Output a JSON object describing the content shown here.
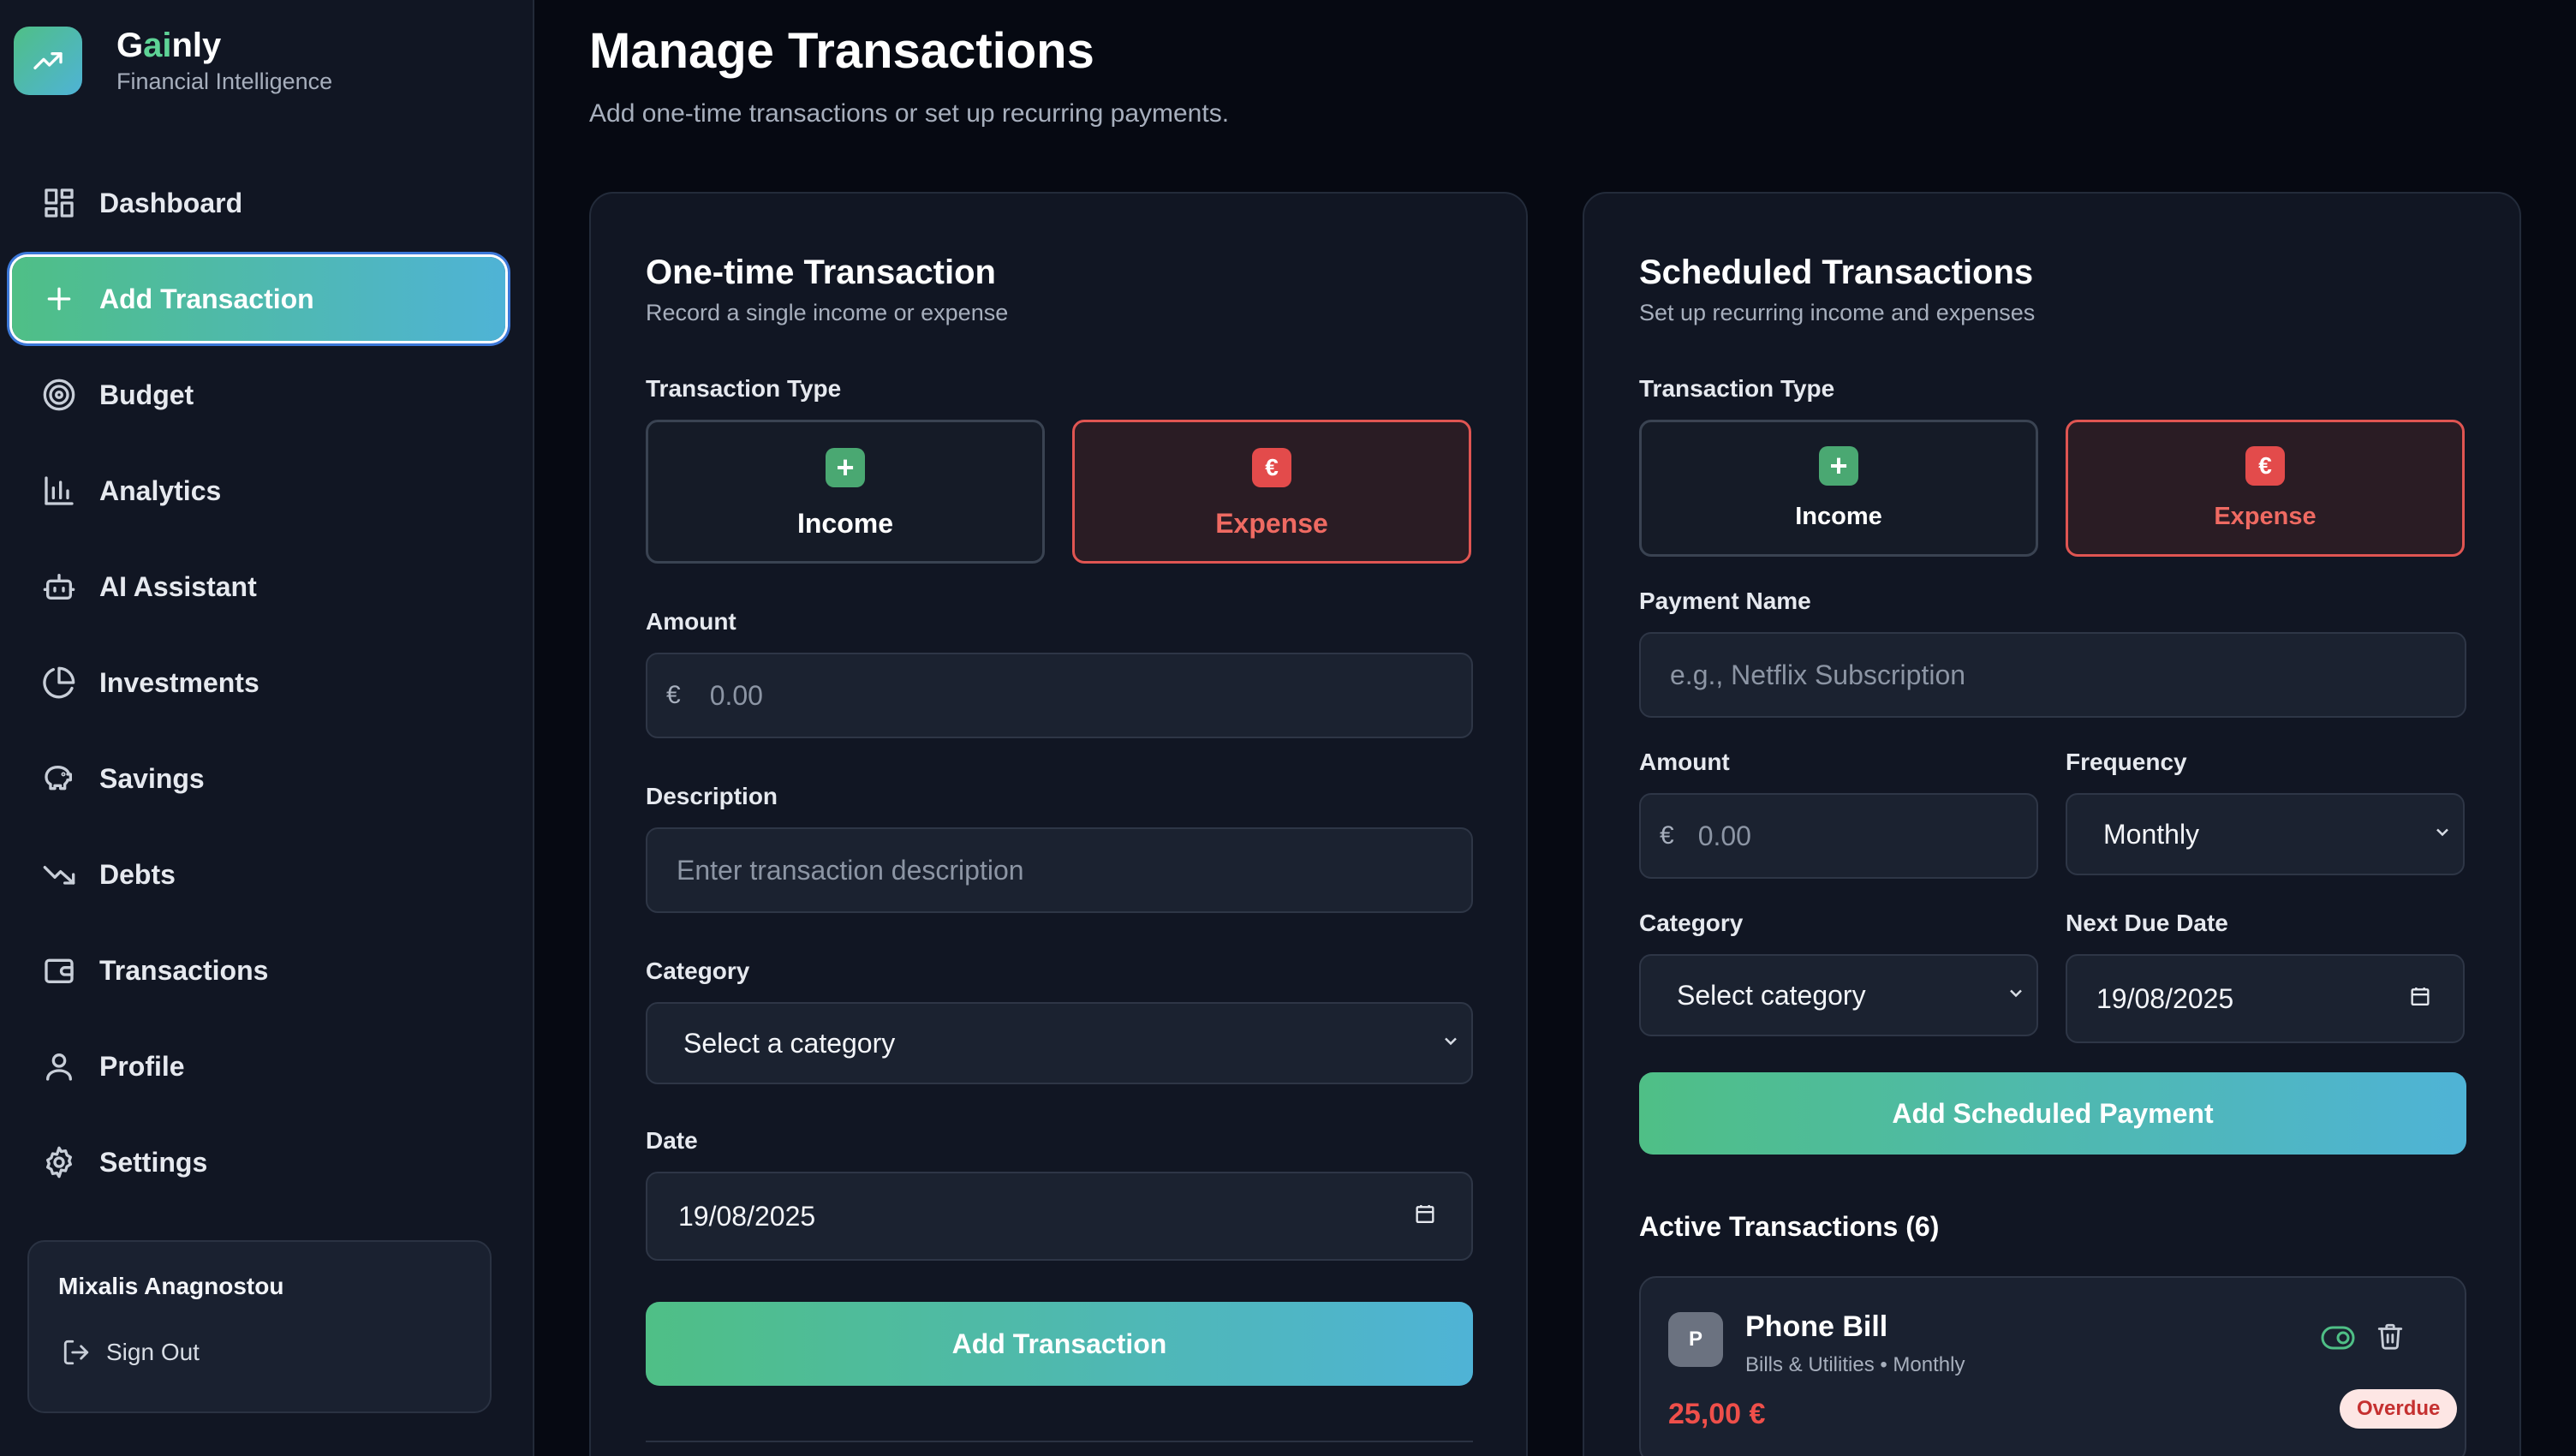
{
  "brand": {
    "name_prefix": "G",
    "name_accent": "ai",
    "name_suffix": "nly",
    "tagline": "Financial Intelligence",
    "logo_icon": "trending-up-icon"
  },
  "sidebar": {
    "items": [
      {
        "label": "Dashboard",
        "icon": "grid-icon",
        "active": false
      },
      {
        "label": "Add Transaction",
        "icon": "plus-icon",
        "active": true
      },
      {
        "label": "Budget",
        "icon": "target-icon",
        "active": false
      },
      {
        "label": "Analytics",
        "icon": "bar-chart-icon",
        "active": false
      },
      {
        "label": "AI Assistant",
        "icon": "bot-icon",
        "active": false
      },
      {
        "label": "Investments",
        "icon": "pie-chart-icon",
        "active": false
      },
      {
        "label": "Savings",
        "icon": "piggy-bank-icon",
        "active": false
      },
      {
        "label": "Debts",
        "icon": "trending-down-icon",
        "active": false
      },
      {
        "label": "Transactions",
        "icon": "wallet-icon",
        "active": false
      },
      {
        "label": "Profile",
        "icon": "user-icon",
        "active": false
      },
      {
        "label": "Settings",
        "icon": "gear-icon",
        "active": false
      }
    ],
    "user": {
      "name": "Mixalis Anagnostou",
      "signout_label": "Sign Out"
    }
  },
  "page": {
    "title": "Manage Transactions",
    "subtitle": "Add one-time transactions or set up recurring payments."
  },
  "one_time": {
    "title": "One-time Transaction",
    "subtitle": "Record a single income or expense",
    "type_label": "Transaction Type",
    "income_label": "Income",
    "expense_label": "Expense",
    "selected_type": "Expense",
    "amount_label": "Amount",
    "currency_symbol": "€",
    "amount_placeholder": "0.00",
    "description_label": "Description",
    "description_placeholder": "Enter transaction description",
    "category_label": "Category",
    "category_value": "Select a category",
    "date_label": "Date",
    "date_value": "19/08/2025",
    "submit_label": "Add Transaction"
  },
  "scheduled": {
    "title": "Scheduled Transactions",
    "subtitle": "Set up recurring income and expenses",
    "type_label": "Transaction Type",
    "income_label": "Income",
    "expense_label": "Expense",
    "selected_type": "Expense",
    "payment_name_label": "Payment Name",
    "payment_name_placeholder": "e.g., Netflix Subscription",
    "amount_label": "Amount",
    "currency_symbol": "€",
    "amount_placeholder": "0.00",
    "frequency_label": "Frequency",
    "frequency_value": "Monthly",
    "category_label": "Category",
    "category_value": "Select category",
    "next_due_label": "Next Due Date",
    "next_due_value": "19/08/2025",
    "submit_label": "Add Scheduled Payment",
    "active_title": "Active Transactions (6)",
    "transactions": [
      {
        "avatar": "P",
        "name": "Phone Bill",
        "meta": "Bills & Utilities • Monthly",
        "amount": "25,00 €",
        "status": "Overdue",
        "enabled": true
      }
    ]
  },
  "colors": {
    "accent_green": "#4fbf86",
    "accent_blue": "#4fb3d6",
    "expense_red": "#e05552",
    "background": "#060912",
    "card": "#111623"
  }
}
